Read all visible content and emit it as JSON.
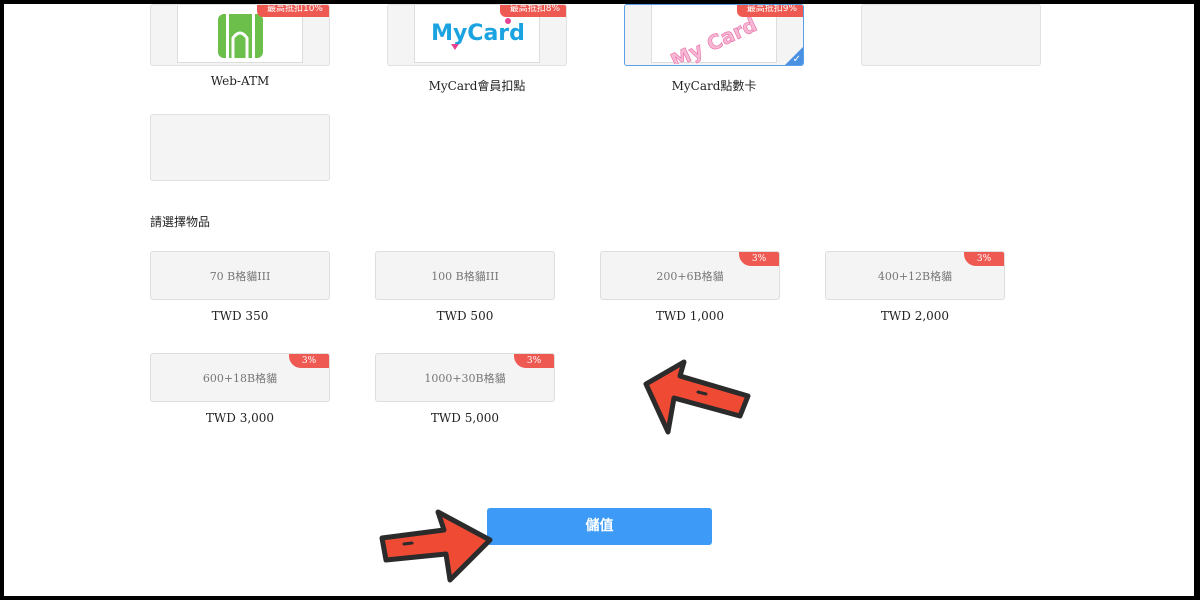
{
  "payment_methods": [
    {
      "name": "Web-ATM",
      "discount": "最高抵扣10%",
      "icon": "atm-icon"
    },
    {
      "name": "MyCard會員扣點",
      "discount": "最高抵扣8%",
      "icon": "mycard-logo",
      "logo_text": "MyCard"
    },
    {
      "name": "MyCard點數卡",
      "discount": "最高抵扣9%",
      "icon": "mycard-card-icon",
      "logo_text": "My Card",
      "selected": true
    },
    {
      "name": "",
      "discount": "",
      "icon": "blurred-icon"
    },
    {
      "name": "",
      "discount": "",
      "icon": "blurred-icon"
    }
  ],
  "items_section": {
    "title": "請選擇物品",
    "items": [
      {
        "name": "70 B格貓III",
        "price": "TWD 350",
        "badge": ""
      },
      {
        "name": "100 B格貓III",
        "price": "TWD 500",
        "badge": ""
      },
      {
        "name": "200+6B格貓",
        "price": "TWD 1,000",
        "badge": "3%"
      },
      {
        "name": "400+12B格貓",
        "price": "TWD 2,000",
        "badge": "3%"
      },
      {
        "name": "600+18B格貓",
        "price": "TWD 3,000",
        "badge": "3%"
      },
      {
        "name": "1000+30B格貓",
        "price": "TWD 5,000",
        "badge": "3%"
      }
    ]
  },
  "submit": {
    "label": "儲值"
  },
  "colors": {
    "accent_blue": "#3d9bf7",
    "badge_red": "#ee5a52",
    "arrow_red": "#ee4a34",
    "card_bg": "#f4f4f4"
  }
}
